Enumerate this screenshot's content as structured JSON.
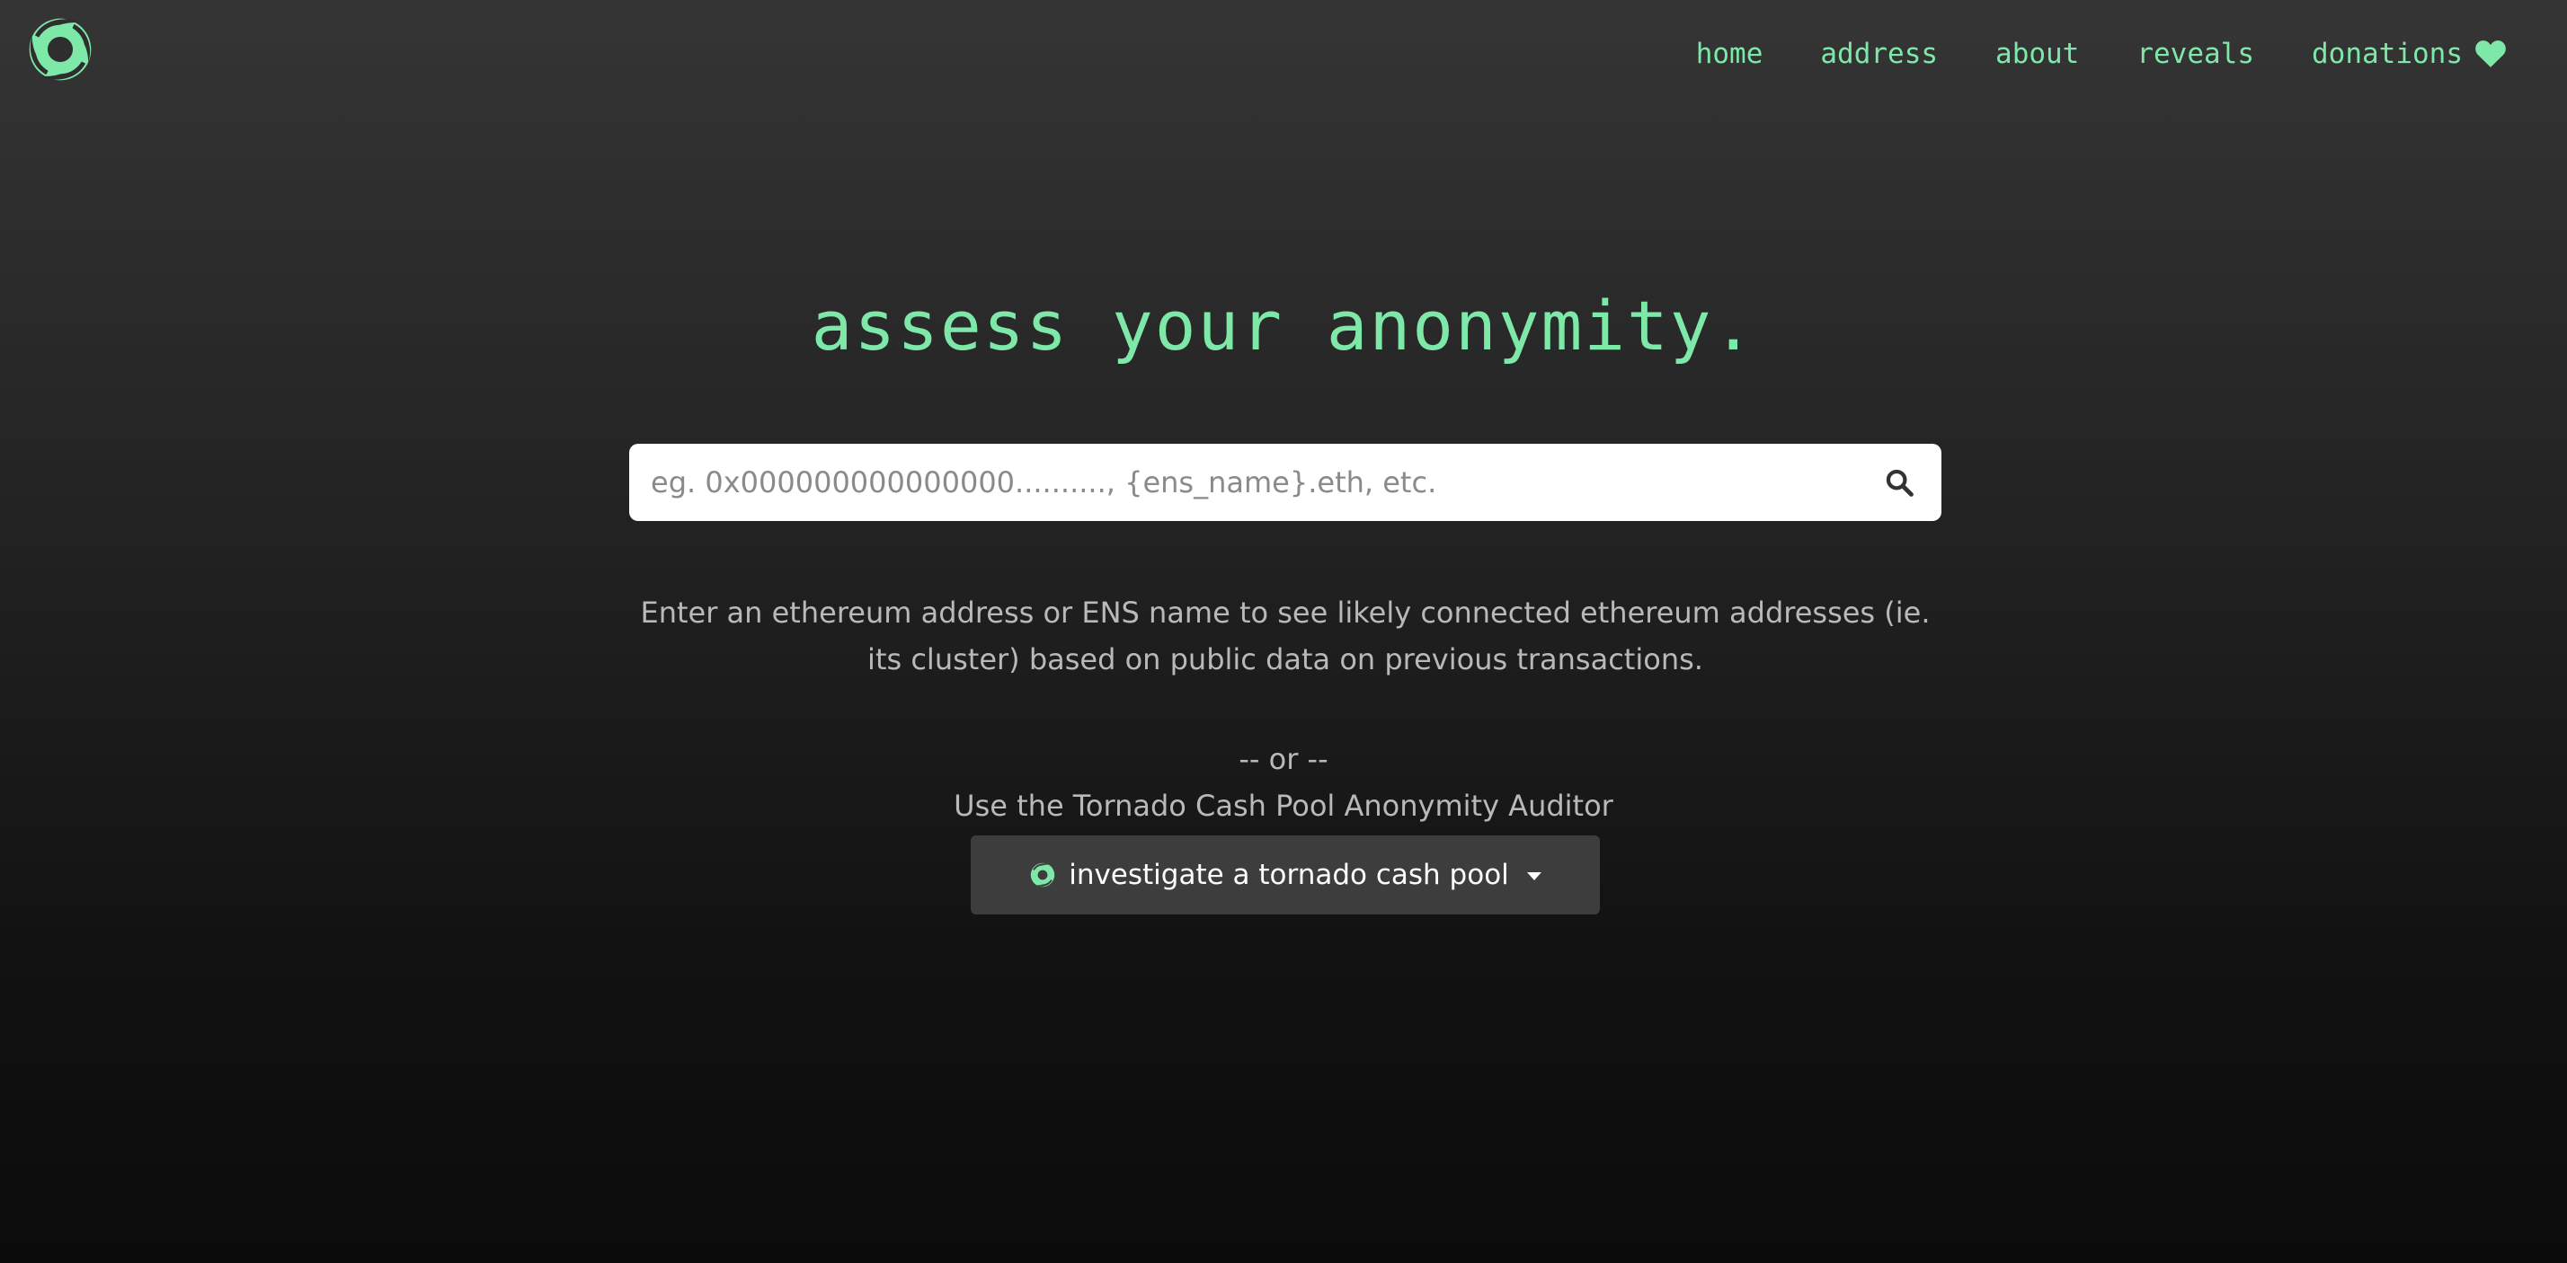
{
  "brand": {
    "logo_icon": "tornado-swirl-logo",
    "accent_color": "#7ee8a8"
  },
  "nav": {
    "items": [
      {
        "label": "home"
      },
      {
        "label": "address"
      },
      {
        "label": "about"
      },
      {
        "label": "reveals"
      },
      {
        "label": "donations",
        "icon": "heart-icon"
      }
    ]
  },
  "hero": {
    "title": "assess your anonymity."
  },
  "search": {
    "placeholder": "eg. 0x000000000000000.........., {ens_name}.eth, etc.",
    "value": "",
    "icon": "search-icon"
  },
  "description": "Enter an ethereum address or ENS name to see likely connected ethereum addresses (ie. its cluster) based on public data on previous transactions.",
  "alternative": {
    "separator": "-- or --",
    "label": "Use the Tornado Cash Pool Anonymity Auditor",
    "button_label": "investigate a tornado cash pool",
    "button_icon": "tornado-swirl-icon",
    "dropdown_icon": "caret-down-icon"
  }
}
